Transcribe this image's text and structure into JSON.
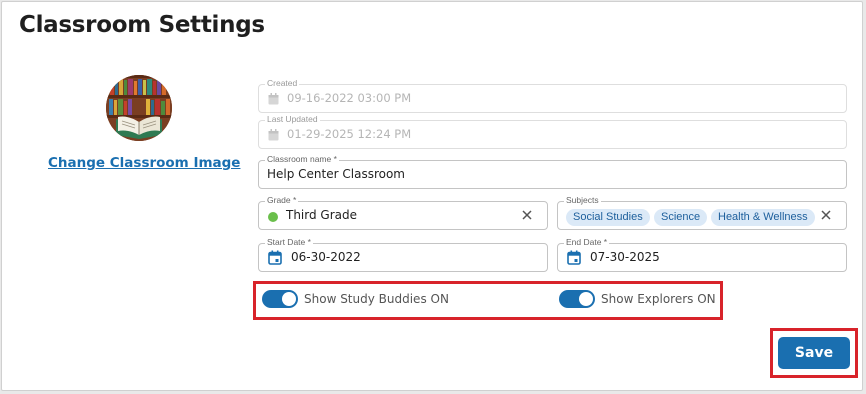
{
  "page": {
    "title": "Classroom Settings"
  },
  "image": {
    "change_label": "Change Classroom Image"
  },
  "fields": {
    "created": {
      "label": "Created",
      "value": "09-16-2022 03:00 PM"
    },
    "last_updated": {
      "label": "Last Updated",
      "value": "01-29-2025 12:24 PM"
    },
    "classroom_name": {
      "label": "Classroom name *",
      "value": "Help Center Classroom"
    },
    "grade": {
      "label": "Grade *",
      "value": "Third Grade",
      "dot_color": "#6abf4b"
    },
    "subjects": {
      "label": "Subjects",
      "chips": [
        "Social Studies",
        "Science",
        "Health & Wellness"
      ]
    },
    "start_date": {
      "label": "Start Date *",
      "value": "06-30-2022"
    },
    "end_date": {
      "label": "End Date *",
      "value": "07-30-2025"
    }
  },
  "toggles": {
    "study_buddies": {
      "label": "Show Study Buddies ON",
      "on": true
    },
    "explorers": {
      "label": "Show Explorers ON",
      "on": true
    }
  },
  "actions": {
    "save_label": "Save"
  },
  "colors": {
    "accent": "#1a6fb0",
    "highlight": "#d8232a",
    "chip_bg": "#dbe9f7"
  }
}
